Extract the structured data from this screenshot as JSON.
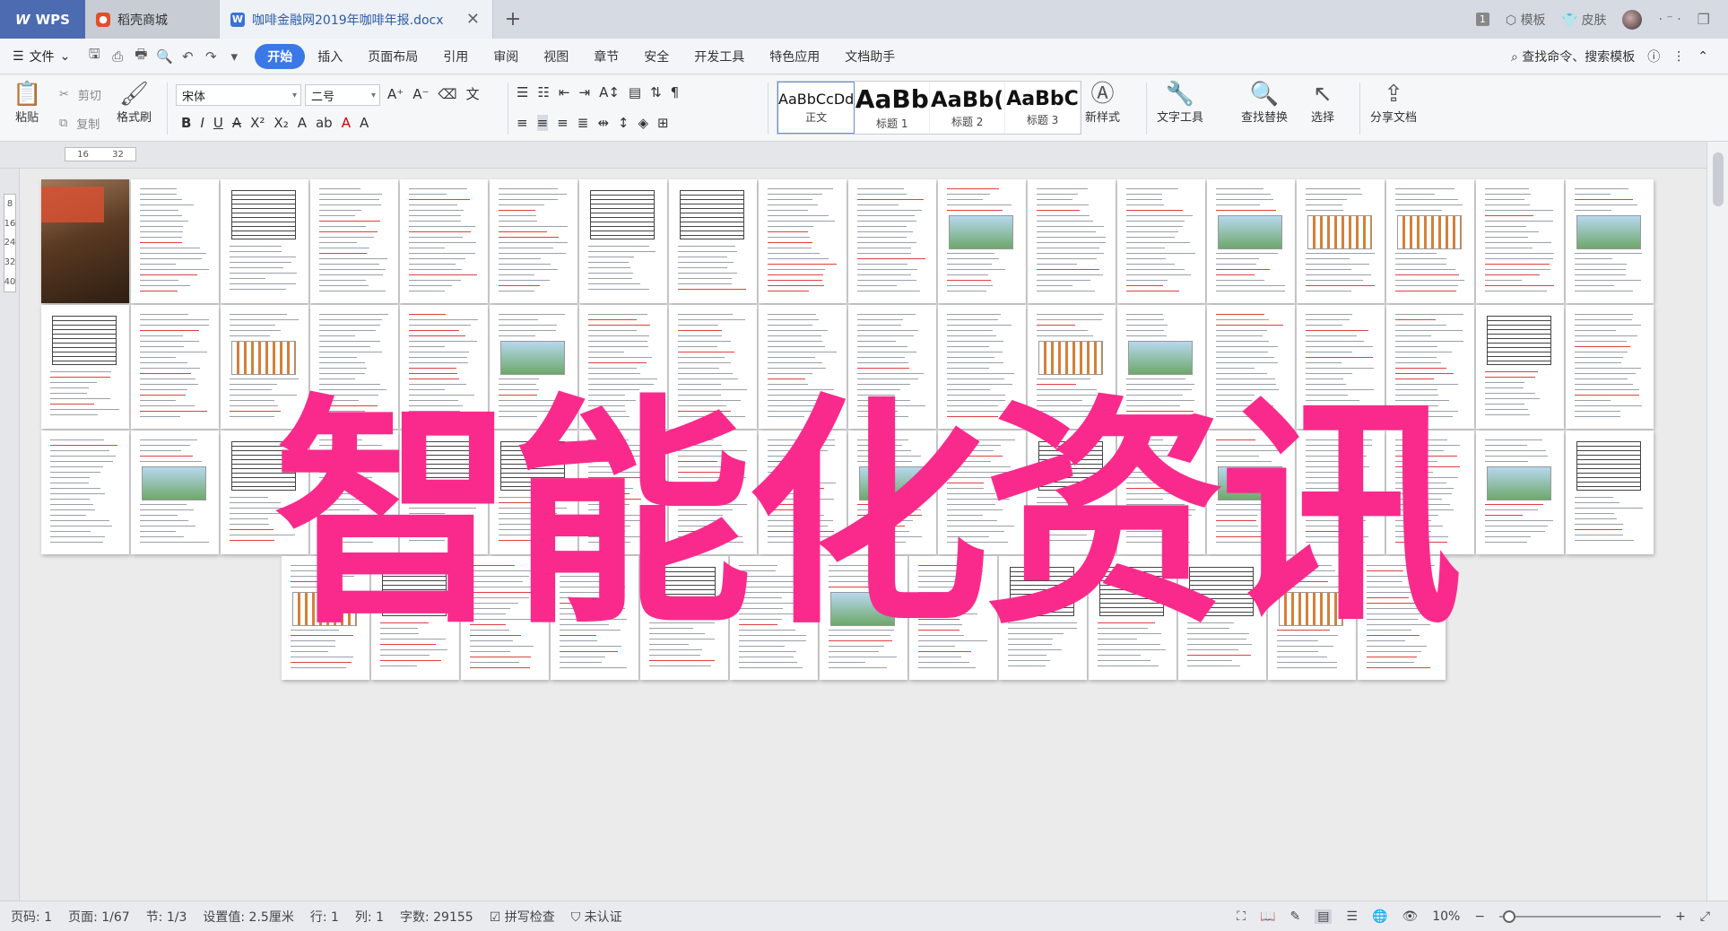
{
  "titlebar": {
    "wps_label": "WPS",
    "tab_daoke": "稻壳商城",
    "tab_doc": "咖啡金融网2019年咖啡年报.docx",
    "page_count_badge": "1",
    "template": "模板",
    "skin": "皮肤"
  },
  "menubar": {
    "file": "文件",
    "items": [
      "开始",
      "插入",
      "页面布局",
      "引用",
      "审阅",
      "视图",
      "章节",
      "安全",
      "开发工具",
      "特色应用",
      "文档助手"
    ],
    "search": "查找命令、搜索模板"
  },
  "ribbon": {
    "paste": "粘贴",
    "cut": "剪切",
    "copy": "复制",
    "format_painter": "格式刷",
    "font_name": "宋体",
    "font_size": "二号",
    "styles": [
      {
        "sample": "AaBbCcDd",
        "name": "正文"
      },
      {
        "sample": "AaBb",
        "name": "标题 1"
      },
      {
        "sample": "AaBb(",
        "name": "标题 2"
      },
      {
        "sample": "AaBbC",
        "name": "标题 3"
      }
    ],
    "new_style": "新样式",
    "text_tools": "文字工具",
    "find_replace": "查找替换",
    "select": "选择",
    "share_doc": "分享文档"
  },
  "ruler": {
    "mark1": "16",
    "mark2": "32"
  },
  "vruler": {
    "marks": [
      "8",
      "16",
      "24",
      "32",
      "40"
    ]
  },
  "overlay_text": "智能化资讯",
  "status": {
    "page_num": "页码: 1",
    "page": "页面: 1/67",
    "section": "节: 1/3",
    "setting": "设置值: 2.5厘米",
    "row": "行: 1",
    "col": "列: 1",
    "word_count": "字数: 29155",
    "spell_check": "拼写检查",
    "uncertified": "未认证",
    "zoom": "10%"
  },
  "colors": {
    "overlay": "#fa2a8c",
    "accent": "#3b78e7",
    "wps_tab": "#4c6bb0"
  }
}
